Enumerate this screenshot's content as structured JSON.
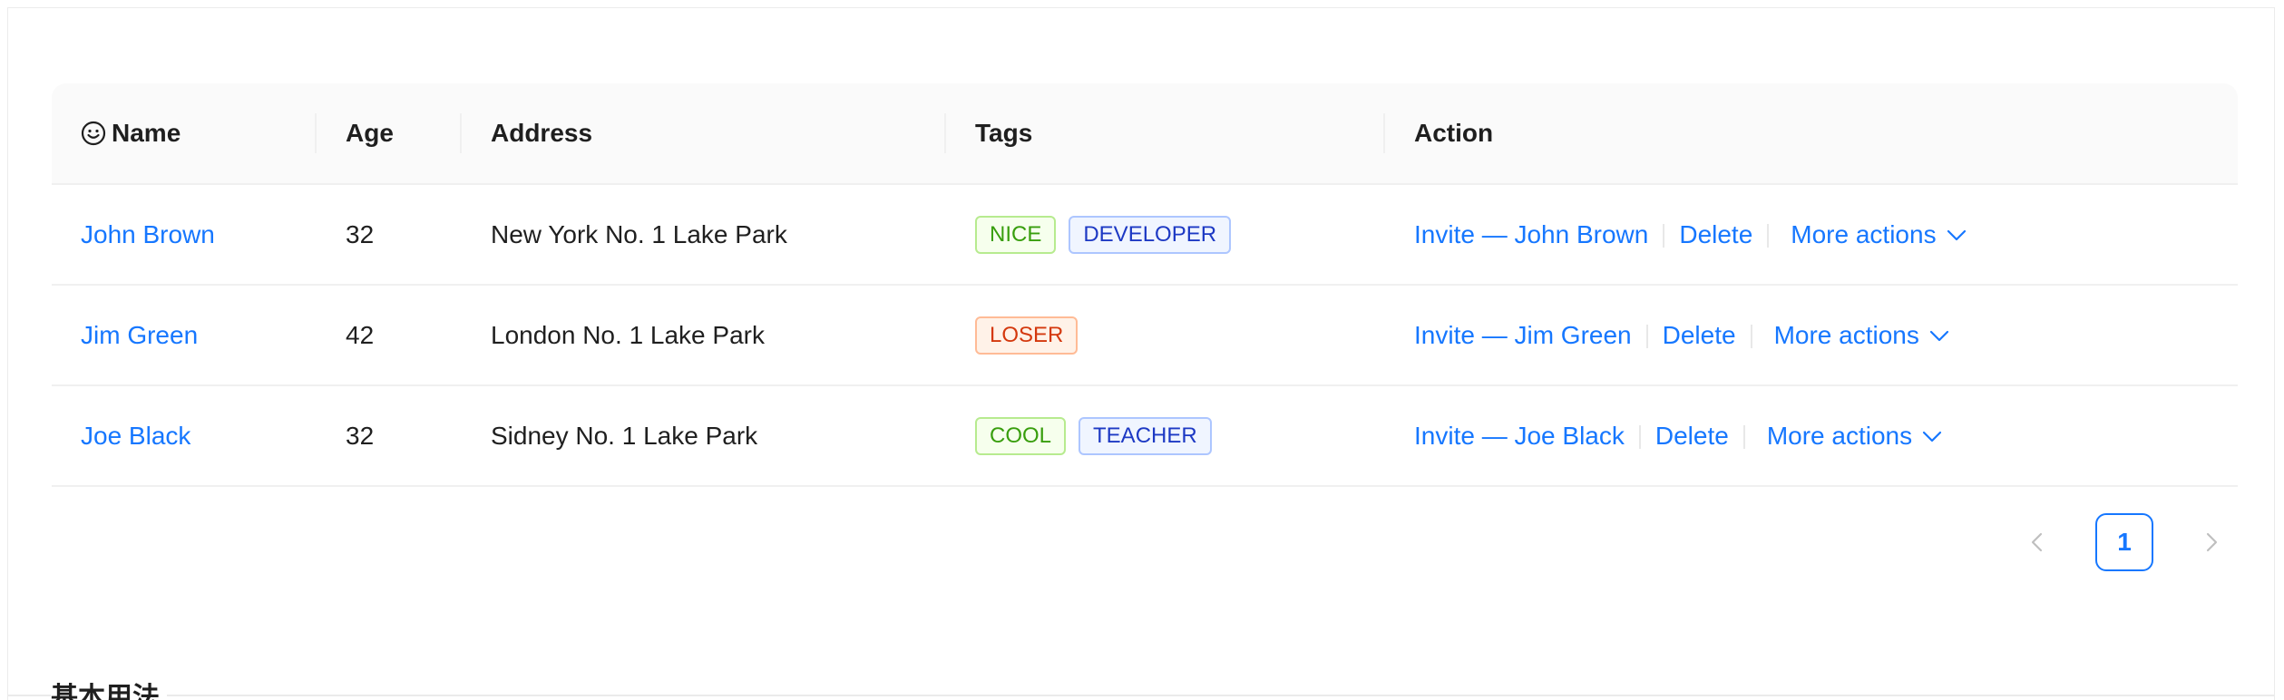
{
  "table": {
    "columns": {
      "name": "Name",
      "age": "Age",
      "address": "Address",
      "tags": "Tags",
      "action": "Action"
    },
    "rows": [
      {
        "name": "John Brown",
        "age": "32",
        "address": "New York No. 1 Lake Park",
        "tags": [
          {
            "label": "NICE",
            "color": "green"
          },
          {
            "label": "DEVELOPER",
            "color": "geekblue"
          }
        ],
        "invite": "Invite — John Brown",
        "delete": "Delete",
        "more": "More actions"
      },
      {
        "name": "Jim Green",
        "age": "42",
        "address": "London No. 1 Lake Park",
        "tags": [
          {
            "label": "LOSER",
            "color": "volcano"
          }
        ],
        "invite": "Invite — Jim Green",
        "delete": "Delete",
        "more": "More actions"
      },
      {
        "name": "Joe Black",
        "age": "32",
        "address": "Sidney No. 1 Lake Park",
        "tags": [
          {
            "label": "COOL",
            "color": "green"
          },
          {
            "label": "TEACHER",
            "color": "geekblue"
          }
        ],
        "invite": "Invite — Joe Black",
        "delete": "Delete",
        "more": "More actions"
      }
    ]
  },
  "pagination": {
    "current": "1",
    "prev_icon": "chevron-left-icon",
    "next_icon": "chevron-right-icon"
  },
  "section": {
    "title": "基本用法"
  },
  "colors": {
    "link": "#1677ff",
    "header_bg": "#fafafa",
    "border": "#f0f0f0"
  }
}
